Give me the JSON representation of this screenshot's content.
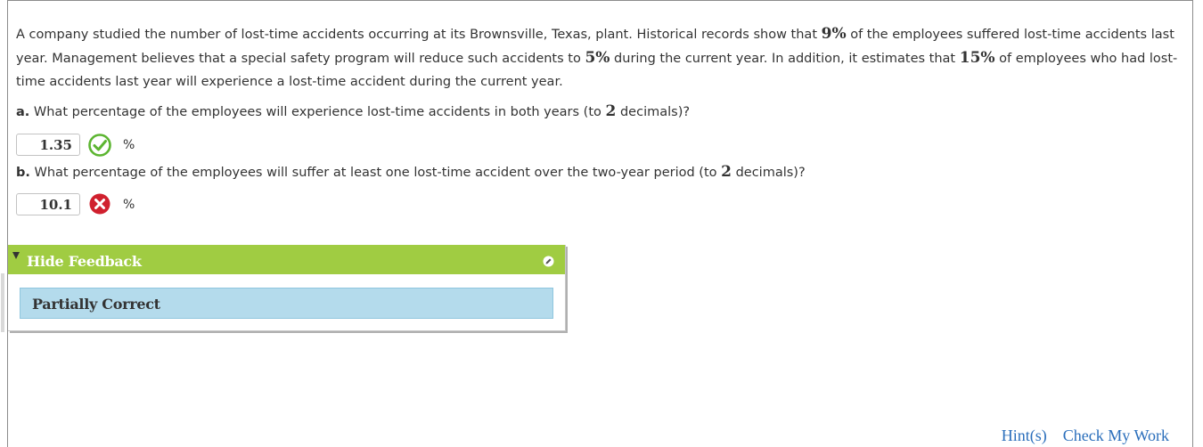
{
  "problem": {
    "p1": "A company studied the number of lost-time accidents occurring at its Brownsville, Texas, plant. Historical records show that ",
    "pct1": "9%",
    "p2": " of the employees suffered lost-time accidents last year. Management believes that a special safety program will reduce such accidents to ",
    "pct2": "5%",
    "p3": " during the current year. In addition, it estimates that ",
    "pct3": "15%",
    "p4": " of employees who had lost-time accidents last year will experience a lost-time accident during the current year."
  },
  "question_a": {
    "letter": "a.",
    "text": " What percentage of the employees will experience lost-time accidents in both years (to ",
    "decimals": "2",
    "end": " decimals)?",
    "answer": "1.35",
    "unit": "%",
    "status": "correct",
    "status_icon": "check-circle-icon"
  },
  "question_b": {
    "letter": "b.",
    "text": " What percentage of the employees will suffer at least one lost-time accident over the two-year period (to ",
    "decimals": "2",
    "end": " decimals)?",
    "answer": "10.1",
    "unit": "%",
    "status": "incorrect",
    "status_icon": "x-circle-icon"
  },
  "feedback": {
    "toggle_label": "Hide Feedback",
    "status_text": "Partially Correct",
    "header_color": "#a0cc42",
    "body_color": "#b4dbec"
  },
  "links": {
    "hint": "Hint(s)",
    "check": "Check My Work"
  },
  "colors": {
    "correct": "#5cb531",
    "incorrect": "#d0202e",
    "link": "#2a6ebb"
  }
}
